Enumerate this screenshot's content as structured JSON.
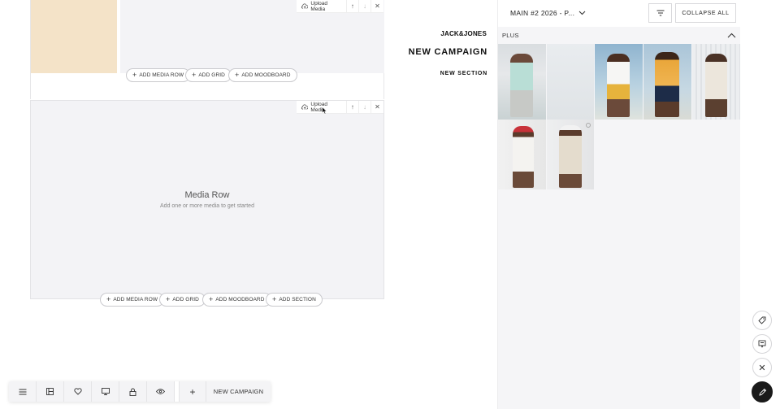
{
  "top_block": {
    "upload_label": "Upload Media",
    "add_buttons": [
      "ADD MEDIA ROW",
      "ADD GRID",
      "ADD MOODBOARD"
    ]
  },
  "media_row_block": {
    "upload_label": "Upload Media",
    "title": "Media Row",
    "subtitle": "Add one or more media to get started",
    "add_buttons": [
      "ADD MEDIA ROW",
      "ADD GRID",
      "ADD MOODBOARD",
      "ADD SECTION"
    ]
  },
  "brand": {
    "logo": "JACK&JONES",
    "campaign_title": "NEW CAMPAIGN",
    "section_label": "NEW SECTION"
  },
  "panel": {
    "selector_label": "MAIN #2 2026 - P...",
    "collapse_label": "COLLAPSE ALL",
    "group_label": "PLUS"
  },
  "bottom_bar": {
    "new_campaign_label": "NEW CAMPAIGN"
  },
  "colors": {
    "placeholder_beige": "#f4e3c8",
    "canvas_gray": "#f3f3f6",
    "accent_dark": "#1a1a1a"
  }
}
